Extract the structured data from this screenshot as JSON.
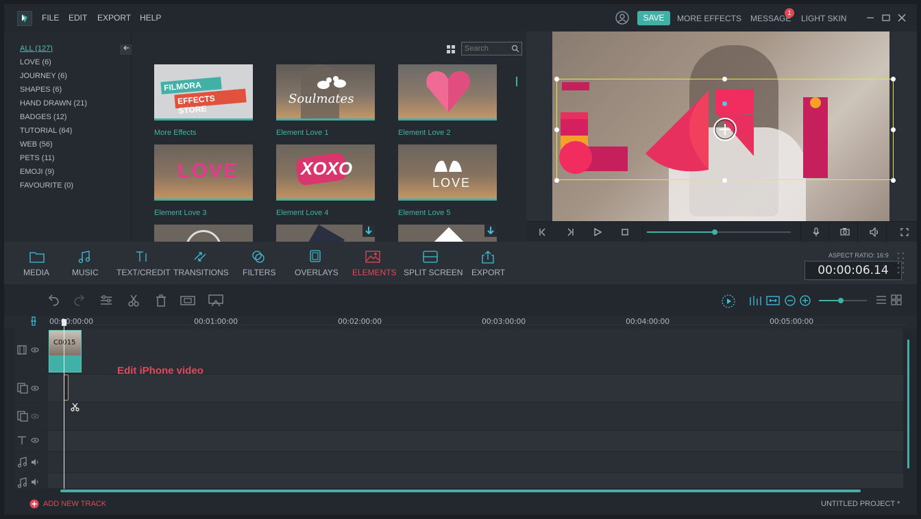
{
  "menu": [
    "FILE",
    "EDIT",
    "EXPORT",
    "HELP"
  ],
  "header": {
    "save": "SAVE",
    "more_effects": "MORE EFFECTS",
    "message": "MESSAGE",
    "message_badge": "1",
    "skin": "LIGHT SKIN"
  },
  "categories": [
    "ALL (127)",
    "LOVE (6)",
    "JOURNEY (6)",
    "SHAPES (6)",
    "HAND DRAWN (21)",
    "BADGES (12)",
    "TUTORIAL (64)",
    "WEB (56)",
    "PETS (11)",
    "EMOJI (9)",
    "FAVOURITE (0)"
  ],
  "search_placeholder": "Search",
  "thumbnails": [
    {
      "label": "More Effects",
      "text": "FILMORA EFFECTS STORE"
    },
    {
      "label": "Element Love 1",
      "text": "Soulmates"
    },
    {
      "label": "Element Love 2",
      "text": ""
    },
    {
      "label": "Element Love 3",
      "text": "LOVE"
    },
    {
      "label": "Element Love 4",
      "text": "XOXO"
    },
    {
      "label": "Element Love 5",
      "text": "LOVE"
    }
  ],
  "toolbar": [
    "MEDIA",
    "MUSIC",
    "TEXT/CREDIT",
    "TRANSITIONS",
    "FILTERS",
    "OVERLAYS",
    "ELEMENTS",
    "SPLIT SCREEN",
    "EXPORT"
  ],
  "active_tool": "ELEMENTS",
  "aspect_ratio": "ASPECT RATIO: 16:9",
  "timecode": "00:00:06.14",
  "ruler": [
    "00:00:00:00",
    "00:01:00:00",
    "00:02:00:00",
    "00:03:00:00",
    "00:04:00:00",
    "00:05:00:00"
  ],
  "clip_name": "C0015",
  "overlay_text": "Edit iPhone video",
  "playback_progress": 0.47,
  "zoom_level": 0.45,
  "add_track": "ADD NEW TRACK",
  "project_name": "UNTITLED PROJECT *",
  "colors": {
    "accent": "#41b1a8",
    "active": "#e2485a",
    "bg": "#23282e"
  }
}
